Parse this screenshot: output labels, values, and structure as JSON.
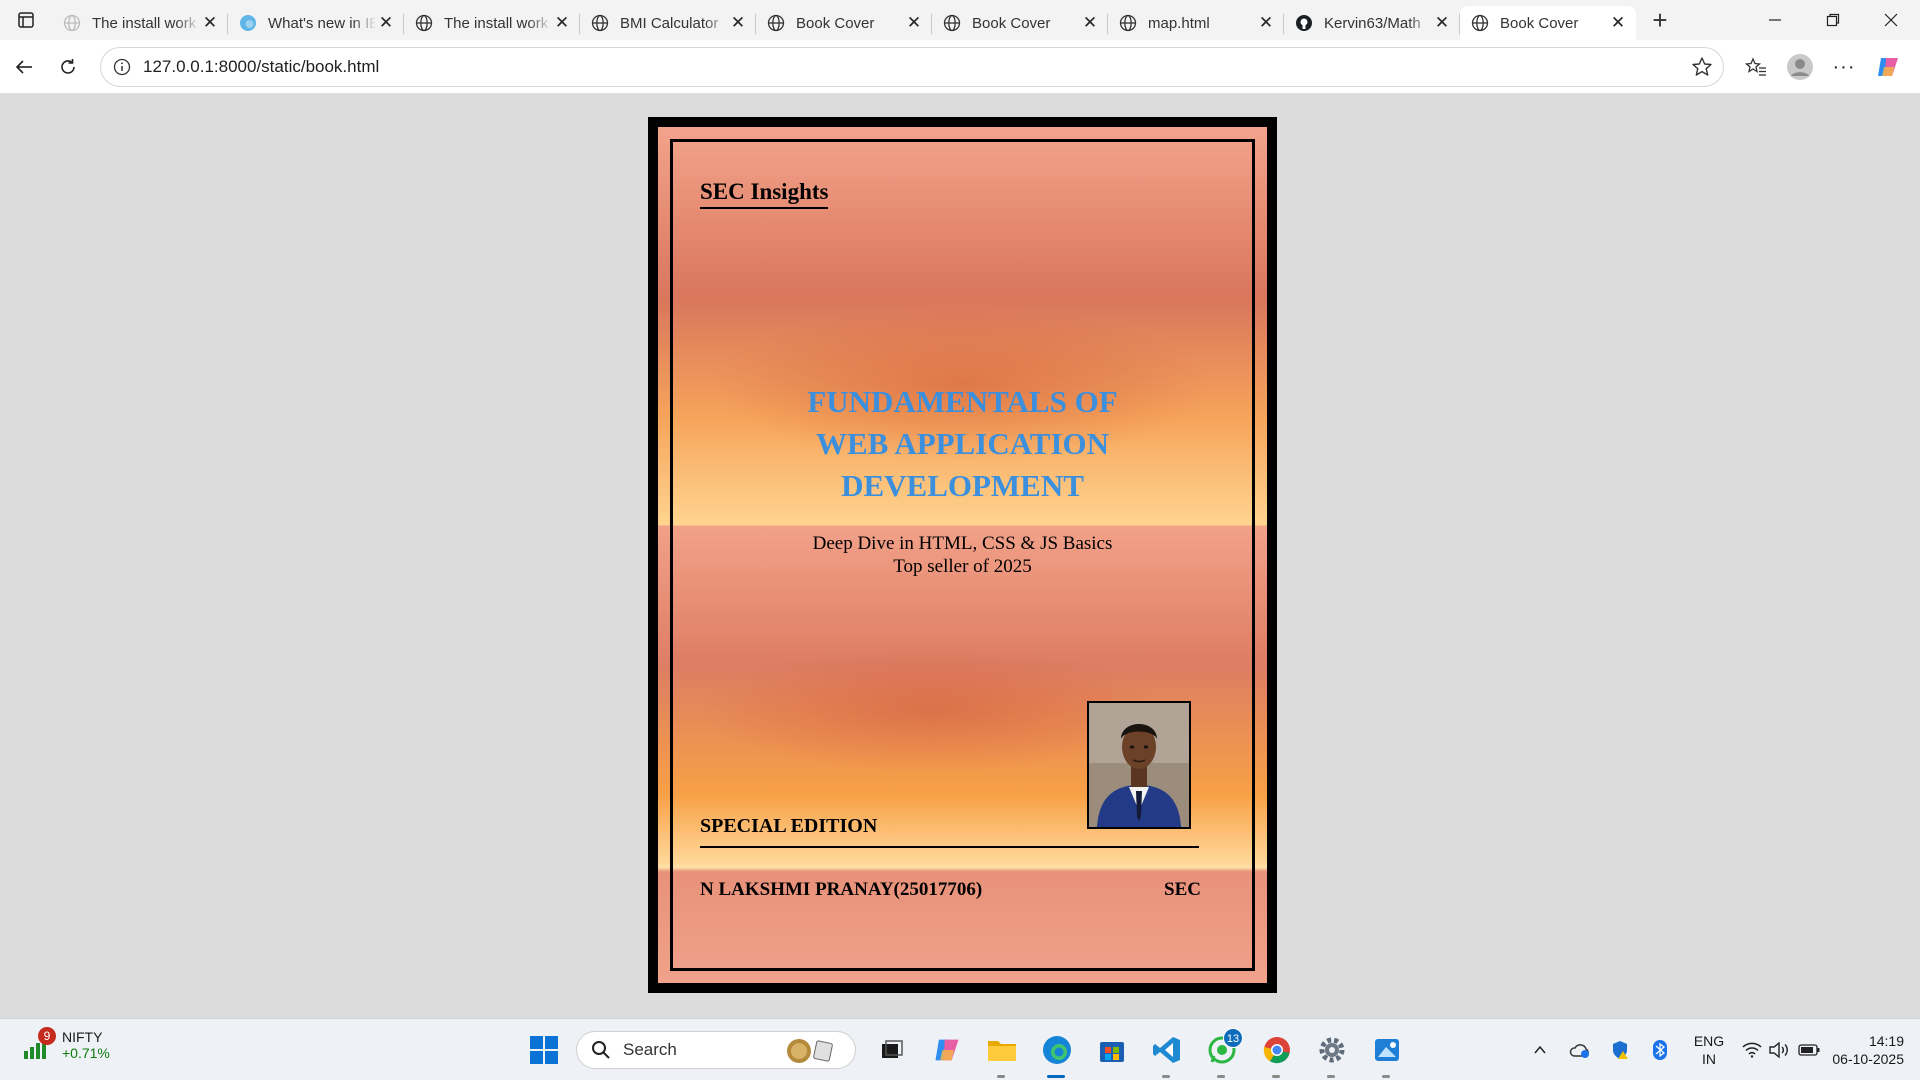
{
  "browser": {
    "tabs": [
      {
        "title": "The install work",
        "icon": "globe-icon",
        "active": false
      },
      {
        "title": "What's new in IE",
        "icon": "edge-icon",
        "active": false
      },
      {
        "title": "The install work",
        "icon": "globe-icon",
        "active": false
      },
      {
        "title": "BMI Calculator",
        "icon": "globe-icon",
        "active": false
      },
      {
        "title": "Book Cover",
        "icon": "globe-icon",
        "active": false
      },
      {
        "title": "Book Cover",
        "icon": "globe-icon",
        "active": false
      },
      {
        "title": "map.html",
        "icon": "globe-icon",
        "active": false
      },
      {
        "title": "Kervin63/Math",
        "icon": "github-icon",
        "active": false
      },
      {
        "title": "Book Cover",
        "icon": "globe-icon",
        "active": true
      }
    ],
    "address": {
      "url": "127.0.0.1:8000/static/book.html"
    }
  },
  "cover": {
    "publisher": "SEC Insights",
    "title_lines": [
      "FUNDAMENTALS OF",
      "WEB APPLICATION",
      "DEVELOPMENT"
    ],
    "subtitle": "Deep Dive in HTML, CSS & JS Basics",
    "tagline": "Top seller of 2025",
    "edition": "SPECIAL EDITION",
    "author": "N LAKSHMI PRANAY(25017706)",
    "organization": "SEC",
    "colors": {
      "title": "#3b8fdd",
      "frame": "#000000"
    }
  },
  "taskbar": {
    "widget": {
      "name": "NIFTY",
      "value": "+0.71%",
      "badge": "9"
    },
    "search_placeholder": "Search",
    "whatsapp_badge": "13",
    "tray": {
      "lang_top": "ENG",
      "lang_bottom": "IN",
      "time": "14:19",
      "date": "06-10-2025"
    }
  }
}
